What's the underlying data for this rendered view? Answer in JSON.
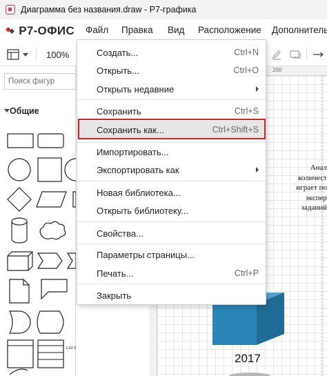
{
  "window": {
    "title": "Диаграмма без названия.draw - Р7-графика"
  },
  "app": {
    "logo_text": "Р7-ОФИС"
  },
  "menubar": [
    "Файл",
    "Правка",
    "Вид",
    "Расположение",
    "Дополнительно"
  ],
  "toolbar": {
    "zoom": "100%"
  },
  "sidebar": {
    "search_placeholder": "Поиск фигур",
    "group_title": "Общие",
    "list_item_label": "List Item"
  },
  "ruler": {
    "mark": "200"
  },
  "file_menu": {
    "items": [
      {
        "label": "Создать...",
        "shortcut": "Ctrl+N"
      },
      {
        "label": "Открыть...",
        "shortcut": "Ctrl+O"
      },
      {
        "label": "Открыть недавние",
        "submenu": true
      },
      {
        "label": "Сохранить",
        "shortcut": "Ctrl+S"
      },
      {
        "label": "Сохранить как...",
        "shortcut": "Ctrl+Shift+S",
        "highlighted": true
      },
      {
        "label": "Импортировать..."
      },
      {
        "label": "Экспортировать как",
        "submenu": true
      },
      {
        "label": "Новая библиотека..."
      },
      {
        "label": "Открыть библиотеку..."
      },
      {
        "label": "Свойства..."
      },
      {
        "label": "Параметры страницы..."
      },
      {
        "label": "Печать...",
        "shortcut": "Ctrl+P"
      },
      {
        "label": "Закрыть"
      }
    ]
  },
  "canvas": {
    "text_lines": [
      "Анал",
      "количест",
      "играет по",
      "экспер",
      "заданий"
    ],
    "year": "2017"
  },
  "colors": {
    "highlight": "#d6202a",
    "cube_front": "#2b84b6",
    "cube_top": "#4fa3cf",
    "cube_side": "#1f6c97",
    "logo_red": "#d9262b"
  }
}
